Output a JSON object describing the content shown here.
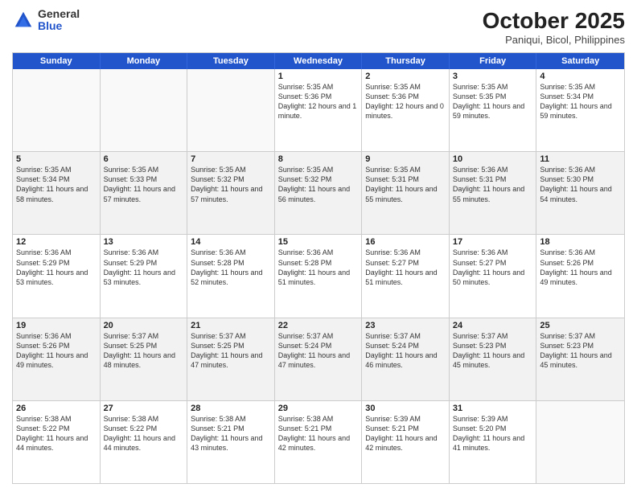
{
  "logo": {
    "general": "General",
    "blue": "Blue"
  },
  "title": "October 2025",
  "subtitle": "Paniqui, Bicol, Philippines",
  "header_days": [
    "Sunday",
    "Monday",
    "Tuesday",
    "Wednesday",
    "Thursday",
    "Friday",
    "Saturday"
  ],
  "rows": [
    [
      {
        "day": "",
        "text": "",
        "empty": true
      },
      {
        "day": "",
        "text": "",
        "empty": true
      },
      {
        "day": "",
        "text": "",
        "empty": true
      },
      {
        "day": "1",
        "text": "Sunrise: 5:35 AM\nSunset: 5:36 PM\nDaylight: 12 hours\nand 1 minute."
      },
      {
        "day": "2",
        "text": "Sunrise: 5:35 AM\nSunset: 5:36 PM\nDaylight: 12 hours\nand 0 minutes."
      },
      {
        "day": "3",
        "text": "Sunrise: 5:35 AM\nSunset: 5:35 PM\nDaylight: 11 hours\nand 59 minutes."
      },
      {
        "day": "4",
        "text": "Sunrise: 5:35 AM\nSunset: 5:34 PM\nDaylight: 11 hours\nand 59 minutes."
      }
    ],
    [
      {
        "day": "5",
        "text": "Sunrise: 5:35 AM\nSunset: 5:34 PM\nDaylight: 11 hours\nand 58 minutes."
      },
      {
        "day": "6",
        "text": "Sunrise: 5:35 AM\nSunset: 5:33 PM\nDaylight: 11 hours\nand 57 minutes."
      },
      {
        "day": "7",
        "text": "Sunrise: 5:35 AM\nSunset: 5:32 PM\nDaylight: 11 hours\nand 57 minutes."
      },
      {
        "day": "8",
        "text": "Sunrise: 5:35 AM\nSunset: 5:32 PM\nDaylight: 11 hours\nand 56 minutes."
      },
      {
        "day": "9",
        "text": "Sunrise: 5:35 AM\nSunset: 5:31 PM\nDaylight: 11 hours\nand 55 minutes."
      },
      {
        "day": "10",
        "text": "Sunrise: 5:36 AM\nSunset: 5:31 PM\nDaylight: 11 hours\nand 55 minutes."
      },
      {
        "day": "11",
        "text": "Sunrise: 5:36 AM\nSunset: 5:30 PM\nDaylight: 11 hours\nand 54 minutes."
      }
    ],
    [
      {
        "day": "12",
        "text": "Sunrise: 5:36 AM\nSunset: 5:29 PM\nDaylight: 11 hours\nand 53 minutes."
      },
      {
        "day": "13",
        "text": "Sunrise: 5:36 AM\nSunset: 5:29 PM\nDaylight: 11 hours\nand 53 minutes."
      },
      {
        "day": "14",
        "text": "Sunrise: 5:36 AM\nSunset: 5:28 PM\nDaylight: 11 hours\nand 52 minutes."
      },
      {
        "day": "15",
        "text": "Sunrise: 5:36 AM\nSunset: 5:28 PM\nDaylight: 11 hours\nand 51 minutes."
      },
      {
        "day": "16",
        "text": "Sunrise: 5:36 AM\nSunset: 5:27 PM\nDaylight: 11 hours\nand 51 minutes."
      },
      {
        "day": "17",
        "text": "Sunrise: 5:36 AM\nSunset: 5:27 PM\nDaylight: 11 hours\nand 50 minutes."
      },
      {
        "day": "18",
        "text": "Sunrise: 5:36 AM\nSunset: 5:26 PM\nDaylight: 11 hours\nand 49 minutes."
      }
    ],
    [
      {
        "day": "19",
        "text": "Sunrise: 5:36 AM\nSunset: 5:26 PM\nDaylight: 11 hours\nand 49 minutes."
      },
      {
        "day": "20",
        "text": "Sunrise: 5:37 AM\nSunset: 5:25 PM\nDaylight: 11 hours\nand 48 minutes."
      },
      {
        "day": "21",
        "text": "Sunrise: 5:37 AM\nSunset: 5:25 PM\nDaylight: 11 hours\nand 47 minutes."
      },
      {
        "day": "22",
        "text": "Sunrise: 5:37 AM\nSunset: 5:24 PM\nDaylight: 11 hours\nand 47 minutes."
      },
      {
        "day": "23",
        "text": "Sunrise: 5:37 AM\nSunset: 5:24 PM\nDaylight: 11 hours\nand 46 minutes."
      },
      {
        "day": "24",
        "text": "Sunrise: 5:37 AM\nSunset: 5:23 PM\nDaylight: 11 hours\nand 45 minutes."
      },
      {
        "day": "25",
        "text": "Sunrise: 5:37 AM\nSunset: 5:23 PM\nDaylight: 11 hours\nand 45 minutes."
      }
    ],
    [
      {
        "day": "26",
        "text": "Sunrise: 5:38 AM\nSunset: 5:22 PM\nDaylight: 11 hours\nand 44 minutes."
      },
      {
        "day": "27",
        "text": "Sunrise: 5:38 AM\nSunset: 5:22 PM\nDaylight: 11 hours\nand 44 minutes."
      },
      {
        "day": "28",
        "text": "Sunrise: 5:38 AM\nSunset: 5:21 PM\nDaylight: 11 hours\nand 43 minutes."
      },
      {
        "day": "29",
        "text": "Sunrise: 5:38 AM\nSunset: 5:21 PM\nDaylight: 11 hours\nand 42 minutes."
      },
      {
        "day": "30",
        "text": "Sunrise: 5:39 AM\nSunset: 5:21 PM\nDaylight: 11 hours\nand 42 minutes."
      },
      {
        "day": "31",
        "text": "Sunrise: 5:39 AM\nSunset: 5:20 PM\nDaylight: 11 hours\nand 41 minutes."
      },
      {
        "day": "",
        "text": "",
        "empty": true
      }
    ]
  ]
}
